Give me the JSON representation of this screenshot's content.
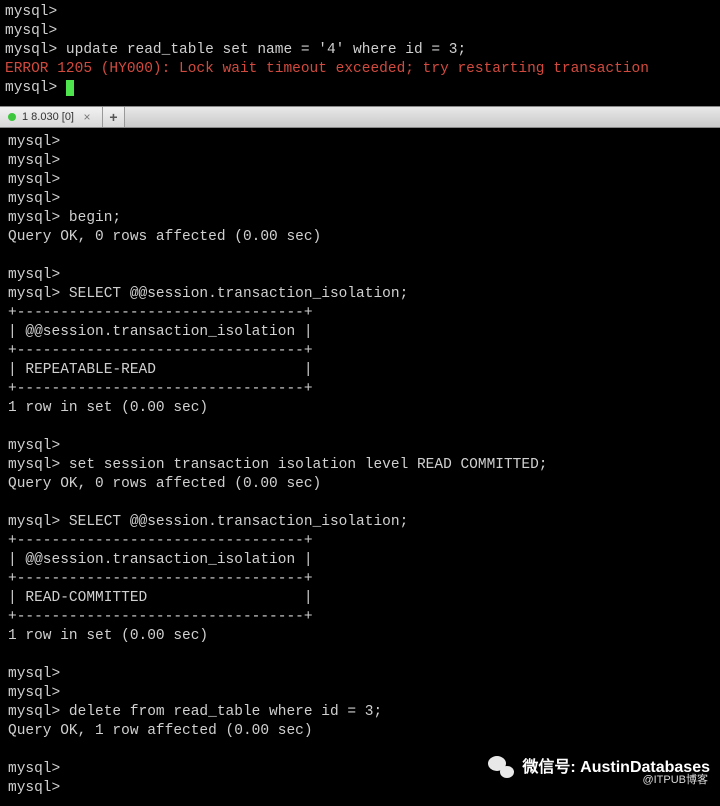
{
  "top_pane": {
    "lines": [
      {
        "text": "mysql>",
        "cls": ""
      },
      {
        "text": "mysql>",
        "cls": ""
      },
      {
        "text": "mysql> update read_table set name = '4' where id = 3;",
        "cls": ""
      },
      {
        "text": "ERROR 1205 (HY000): Lock wait timeout exceeded; try restarting transaction",
        "cls": "red"
      }
    ],
    "prompt_with_cursor": "mysql> "
  },
  "tab_bar": {
    "active_tab_label": "1 8.030 [0]",
    "close_glyph": "×",
    "add_glyph": "+"
  },
  "bottom_pane": {
    "lines": [
      "mysql>",
      "mysql>",
      "mysql>",
      "mysql>",
      "mysql> begin;",
      "Query OK, 0 rows affected (0.00 sec)",
      "",
      "mysql>",
      "mysql> SELECT @@session.transaction_isolation;",
      "+---------------------------------+",
      "| @@session.transaction_isolation |",
      "+---------------------------------+",
      "| REPEATABLE-READ                 |",
      "+---------------------------------+",
      "1 row in set (0.00 sec)",
      "",
      "mysql>",
      "mysql> set session transaction isolation level READ COMMITTED;",
      "Query OK, 0 rows affected (0.00 sec)",
      "",
      "mysql> SELECT @@session.transaction_isolation;",
      "+---------------------------------+",
      "| @@session.transaction_isolation |",
      "+---------------------------------+",
      "| READ-COMMITTED                  |",
      "+---------------------------------+",
      "1 row in set (0.00 sec)",
      "",
      "mysql>",
      "mysql>",
      "mysql> delete from read_table where id = 3;",
      "Query OK, 1 row affected (0.00 sec)",
      "",
      "mysql>",
      "mysql>"
    ]
  },
  "watermark": {
    "main": "微信号: AustinDatabases",
    "sub": "@ITPUB博客"
  }
}
